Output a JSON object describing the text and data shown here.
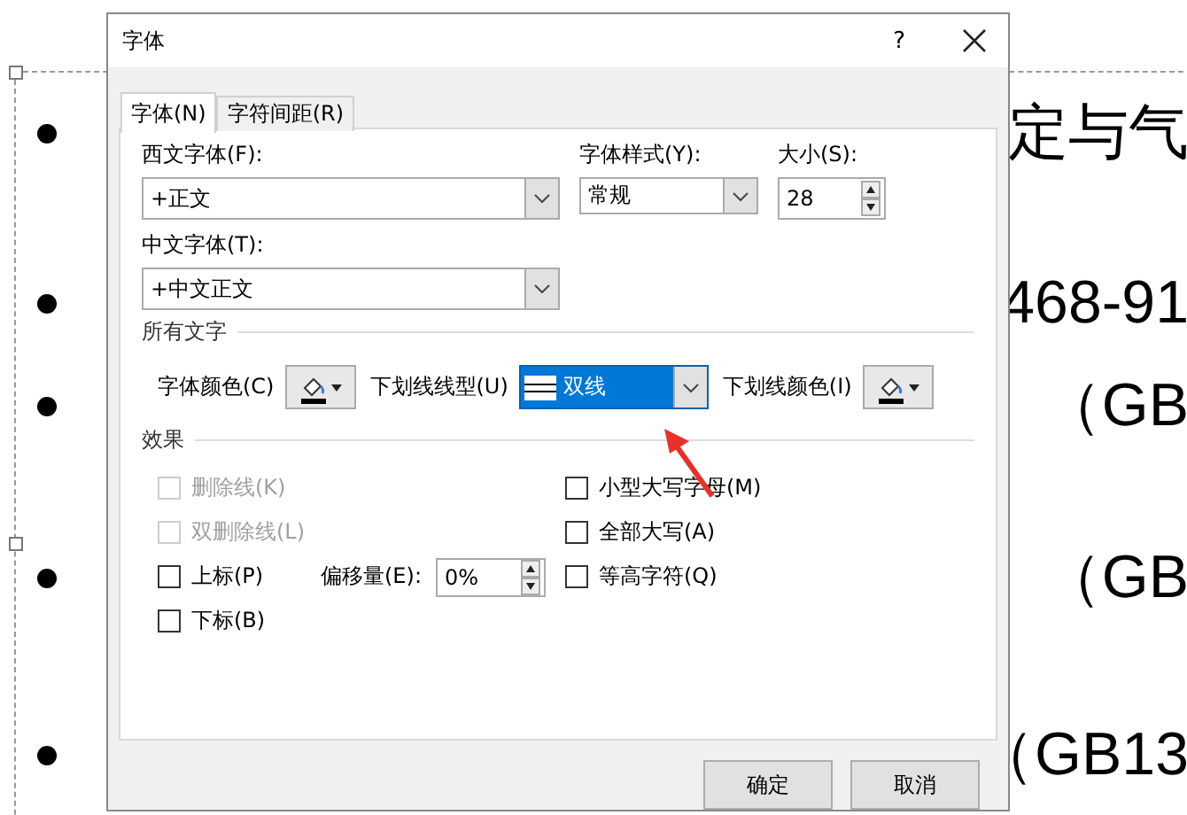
{
  "slide": {
    "lines": [
      {
        "text": "定与气"
      },
      {
        "text": "468-91"
      },
      {
        "text": "（GB"
      },
      {
        "text": "（GB"
      },
      {
        "text": "（GB13"
      }
    ]
  },
  "dialog": {
    "title": "字体",
    "help": "?",
    "tabs": [
      {
        "label": "字体(N)",
        "selected": true
      },
      {
        "label": "字符间距(R)",
        "selected": false
      }
    ],
    "latin_font": {
      "label": "西文字体(F):",
      "value": "+正文"
    },
    "font_style": {
      "label": "字体样式(Y):",
      "value": "常规"
    },
    "size": {
      "label": "大小(S):",
      "value": "28"
    },
    "asian_font": {
      "label": "中文字体(T):",
      "value": "+中文正文"
    },
    "all_text": {
      "heading": "所有文字",
      "font_color_label": "字体颜色(C)",
      "underline_style": {
        "label": "下划线线型(U)",
        "value": "双线",
        "focused": true
      },
      "underline_color_label": "下划线颜色(I)"
    },
    "effects": {
      "heading": "效果",
      "left_checkboxes": [
        {
          "label": "删除线(K)",
          "checked": false,
          "disabled": true
        },
        {
          "label": "双删除线(L)",
          "checked": false,
          "disabled": true
        },
        {
          "label": "上标(P)",
          "checked": false,
          "disabled": false
        },
        {
          "label": "下标(B)",
          "checked": false,
          "disabled": false
        }
      ],
      "right_checkboxes": [
        {
          "label": "小型大写字母(M)",
          "checked": false,
          "disabled": false
        },
        {
          "label": "全部大写(A)",
          "checked": false,
          "disabled": false
        },
        {
          "label": "等高字符(Q)",
          "checked": false,
          "disabled": false
        }
      ],
      "offset": {
        "label": "偏移量(E):",
        "value": "0%"
      }
    },
    "buttons": [
      {
        "label": "确定"
      },
      {
        "label": "取消"
      }
    ]
  }
}
